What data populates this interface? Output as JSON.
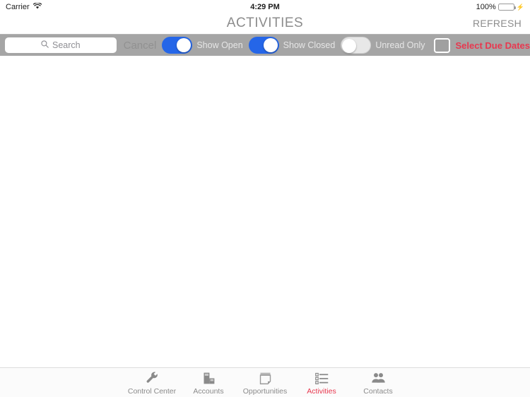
{
  "status_bar": {
    "carrier": "Carrier",
    "wifi_icon": "wifi-icon",
    "time": "4:29 PM",
    "battery_percent": "100%",
    "battery_icon": "battery-full-icon",
    "charging_icon": "lightning-bolt-icon"
  },
  "nav_bar": {
    "title": "ACTIVITIES",
    "refresh_label": "REFRESH"
  },
  "toolbar": {
    "search": {
      "icon": "search-icon",
      "placeholder": "Search",
      "value": ""
    },
    "cancel_label": "Cancel",
    "filters": [
      {
        "label": "Show Open",
        "state": "on"
      },
      {
        "label": "Show Closed",
        "state": "on"
      },
      {
        "label": "Unread Only",
        "state": "off"
      }
    ],
    "due_dates_checkbox": {
      "checked": false,
      "icon": "checkbox-icon"
    },
    "due_dates_label": "Select Due Dates"
  },
  "content": {
    "empty": true,
    "items": []
  },
  "tab_bar": {
    "active_index": 3,
    "tabs": [
      {
        "label": "Control Center",
        "icon": "wrench-icon"
      },
      {
        "label": "Accounts",
        "icon": "buildings-icon"
      },
      {
        "label": "Opportunities",
        "icon": "notepad-icon"
      },
      {
        "label": "Activities",
        "icon": "checklist-icon"
      },
      {
        "label": "Contacts",
        "icon": "people-icon"
      }
    ]
  },
  "colors": {
    "accent_red": "#e8384f",
    "toggle_blue": "#2566e8",
    "toolbar_gray": "#a5a5a5",
    "battery_green": "#4cd964",
    "nav_text_gray": "#8c8c8c"
  }
}
